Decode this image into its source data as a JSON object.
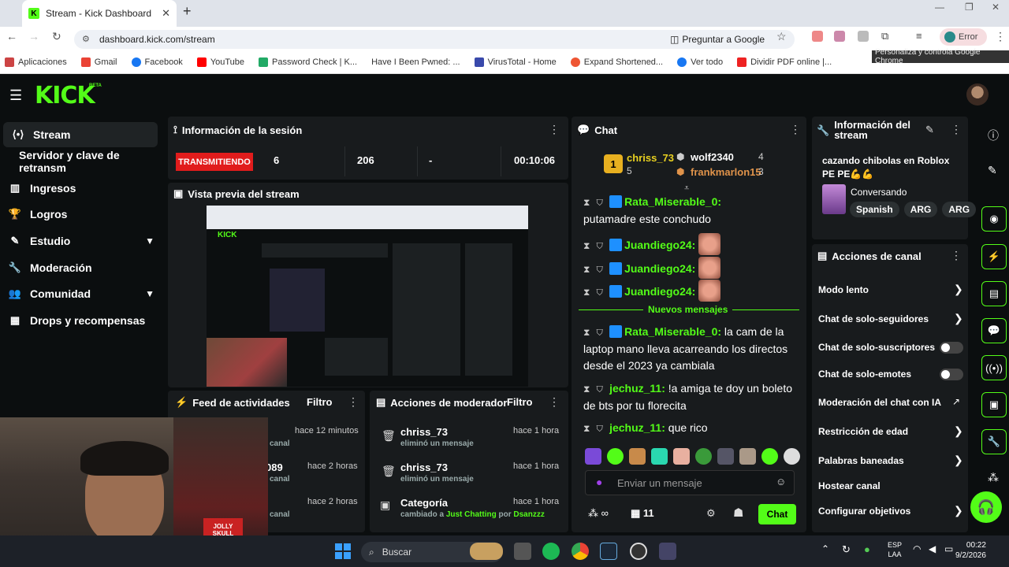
{
  "browser": {
    "tab_title": "Stream - Kick Dashboard",
    "url": "dashboard.kick.com/stream",
    "ask_google": "Preguntar a Google",
    "error_label": "Error",
    "tooltip": "Personaliza y controla Google Chrome",
    "bookmarks": [
      "Aplicaciones",
      "Gmail",
      "Facebook",
      "YouTube",
      "Password Check | K...",
      "Have I Been Pwned: ...",
      "VirusTotal - Home",
      "Expand Shortened...",
      "Ver todo",
      "Dividir PDF online |..."
    ]
  },
  "app": {
    "logo": "KICK",
    "beta": "BETA",
    "sidebar": [
      {
        "label": "Stream",
        "icon": "stream-icon"
      },
      {
        "label": "Servidor y clave de retransm",
        "icon": ""
      },
      {
        "label": "Ingresos",
        "icon": "chart-icon"
      },
      {
        "label": "Logros",
        "icon": "trophy-icon"
      },
      {
        "label": "Estudio",
        "icon": "brush-icon"
      },
      {
        "label": "Moderación",
        "icon": "wrench-icon"
      },
      {
        "label": "Comunidad",
        "icon": "people-icon"
      },
      {
        "label": "Drops y recompensas",
        "icon": "gift-icon"
      }
    ]
  },
  "session": {
    "title": "Información de la sesión",
    "status": "TRANSMITIENDO",
    "viewers": "6",
    "followers": "206",
    "subs": "-",
    "duration": "00:10:06"
  },
  "preview": {
    "title": "Vista previa del stream"
  },
  "activity": {
    "title": "Feed de actividades",
    "filter": "Filtro",
    "rows": [
      {
        "time": "hace 12 minutos",
        "text": "canal"
      },
      {
        "user": "089",
        "time": "hace 2 horas",
        "text": "canal"
      },
      {
        "time": "hace 2 horas",
        "text": "canal"
      }
    ]
  },
  "modactions": {
    "title": "Acciones de moderador",
    "filter": "Filtro",
    "rows": [
      {
        "user": "chriss_73",
        "time": "hace 1 hora",
        "text": "eliminó un mensaje"
      },
      {
        "user": "chriss_73",
        "time": "hace 1 hora",
        "text": "eliminó un mensaje"
      },
      {
        "user": "Categoría",
        "time": "hace 1 hora",
        "text_prefix": "cambiado a",
        "category": "Just Chatting",
        "by": "por",
        "by_user": "Dsanzzz"
      }
    ]
  },
  "chat": {
    "title": "Chat",
    "top": [
      {
        "rank": "1",
        "name": "chriss_73",
        "count": "5"
      },
      {
        "name": "wolf2340",
        "count": "4"
      },
      {
        "name": "frankmarlon15",
        "count": "3"
      }
    ],
    "messages": [
      {
        "user": "Rata_Miserable_0",
        "text": "putamadre este conchudo"
      },
      {
        "user": "Juandiego24",
        "text": ""
      },
      {
        "user": "Juandiego24",
        "text": ""
      },
      {
        "user": "Juandiego24",
        "text": ""
      }
    ],
    "new_messages": "Nuevos mensajes",
    "messages_new": [
      {
        "user": "Rata_Miserable_0",
        "text": "la cam de la laptop mano lleva acarreando los directos desde el 2023 ya cambiala"
      },
      {
        "user": "jechuz_11",
        "text": "!a amiga te doy un boleto de bts por tu florecita"
      },
      {
        "user": "jechuz_11",
        "text": "que rico"
      }
    ],
    "input_placeholder": "Enviar un mensaje",
    "points": "∞",
    "gifts": "11",
    "send": "Chat"
  },
  "channel_info": {
    "title": "Información del stream",
    "stream_title": "cazando chibolas en Roblox PE PE💪💪",
    "category": "Conversando",
    "tags": [
      "Spanish",
      "ARG",
      "ARG"
    ]
  },
  "channel_actions": {
    "title": "Acciones de canal",
    "items": [
      {
        "label": "Modo lento",
        "type": "chevron"
      },
      {
        "label": "Chat de solo-seguidores",
        "type": "chevron"
      },
      {
        "label": "Chat de solo-suscriptores",
        "type": "toggle"
      },
      {
        "label": "Chat de solo-emotes",
        "type": "toggle"
      },
      {
        "label": "Moderación del chat con IA",
        "type": "external"
      },
      {
        "label": "Restricción de edad",
        "type": "chevron"
      },
      {
        "label": "Palabras baneadas",
        "type": "chevron"
      },
      {
        "label": "Hostear canal",
        "type": "none"
      },
      {
        "label": "Configurar objetivos",
        "type": "chevron"
      }
    ]
  },
  "webcam": {
    "sign": "JOLLY SKULL"
  },
  "taskbar": {
    "search": "Buscar",
    "lang": "ESP",
    "lang2": "LAA",
    "time": "00:22",
    "date": "9/2/2026"
  }
}
